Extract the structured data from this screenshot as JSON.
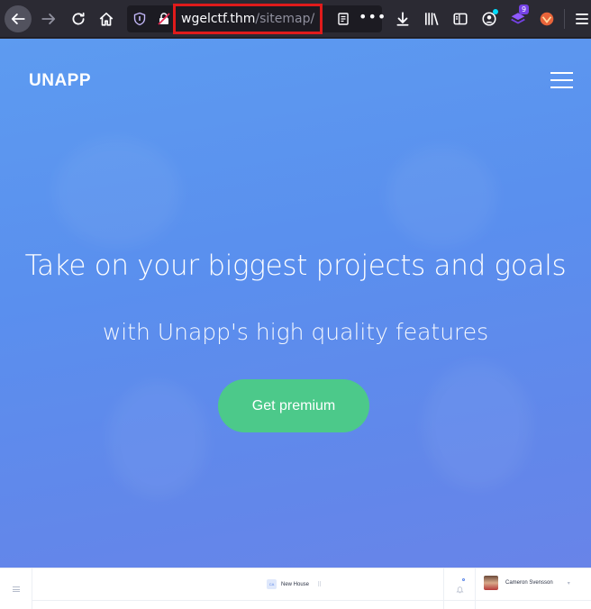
{
  "browser": {
    "url_host": "wgelctf.thm",
    "url_path": "/sitemap/",
    "extension_badge": "9"
  },
  "site": {
    "logo": "UNAPP",
    "headline": "Take on your biggest projects and goals",
    "subheadline": "with Unapp's high quality features",
    "cta_label": "Get premium"
  },
  "preview": {
    "project_badge": "CA",
    "project_name": "New House",
    "user_name": "Cameron Svensson"
  },
  "colors": {
    "hero_gradient_start": "#5d9bf0",
    "hero_gradient_end": "#6a83e8",
    "cta": "#4cc98a",
    "url_highlight": "#e01b1b"
  }
}
